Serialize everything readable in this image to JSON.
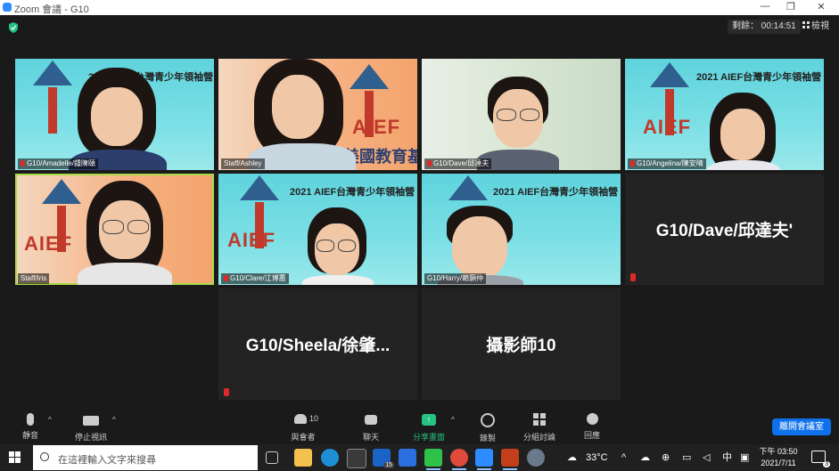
{
  "window": {
    "title": "Zoom 會議 - G10",
    "min": "—",
    "restore": "❐",
    "close": "✕"
  },
  "topbar": {
    "timer": "剩餘： 00:14:51",
    "view_label": "檢視"
  },
  "banner_text": {
    "year_title": "2021 AIEF台灣青少年領袖營",
    "org_name": "美國教育基金會",
    "aief": "AIEF"
  },
  "tiles": [
    {
      "label": "G10/Amadelle/鍾陳頤",
      "muted": true
    },
    {
      "label": "Staff/Ashley",
      "muted": false
    },
    {
      "label": "G10/Dave/邱達夫",
      "muted": true
    },
    {
      "label": "G10/Angelina/陳安晴",
      "muted": true
    },
    {
      "label": "Staff/Iris",
      "muted": false
    },
    {
      "label": "G10/Clare/江博蕙",
      "muted": true
    },
    {
      "label": "G10/Harry/賴顥仲",
      "muted": false
    }
  ],
  "name_tiles": [
    {
      "name": "G10/Dave/邱達夫'"
    },
    {
      "name": "G10/Sheela/徐肇..."
    },
    {
      "name": "攝影師10"
    }
  ],
  "toolbar": {
    "mute": "靜音",
    "stop_video": "停止視訊",
    "participants": "與會者",
    "participants_count": "10",
    "chat": "聊天",
    "share": "分享畫面",
    "record": "錄製",
    "breakout": "分組討論",
    "reactions": "回應",
    "leave": "離開會議室"
  },
  "taskbar": {
    "search_placeholder": "在這裡輸入文字來搜尋",
    "weather": "33°C",
    "ime": "中",
    "time": "下午 03:50",
    "date": "2021/7/11",
    "mail_badge": "15",
    "notif_badge": "3"
  },
  "colors": {
    "accent": "#0e71eb",
    "share_green": "#26c281",
    "active_speaker": "#a8d94b",
    "muted_red": "#e02828"
  }
}
